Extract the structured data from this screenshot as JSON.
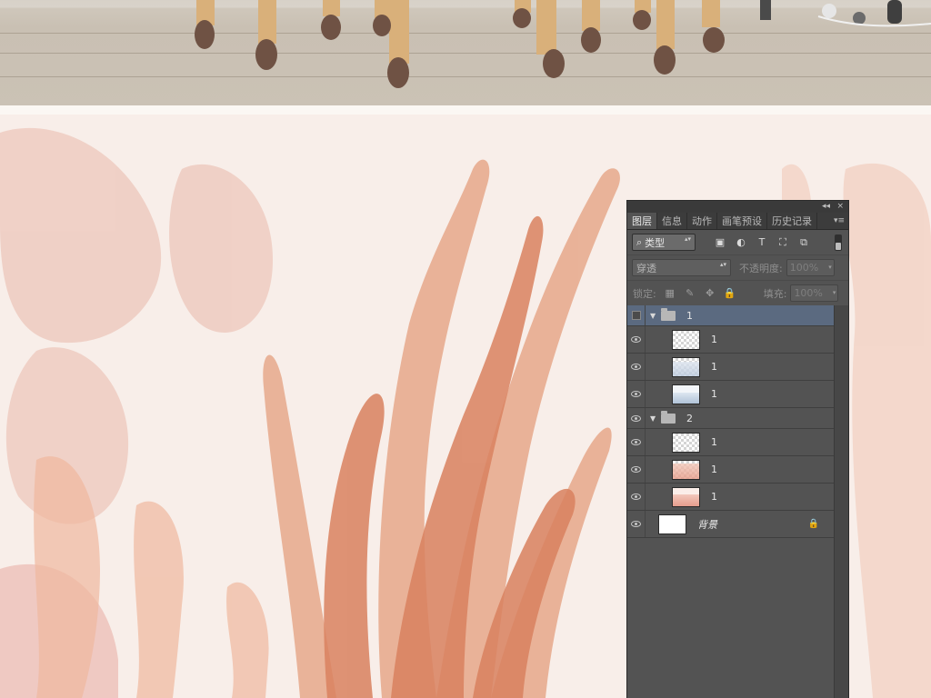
{
  "panel": {
    "collapse_glyph": "◂◂",
    "close_glyph": "×",
    "menu_glyph": "▾≡",
    "tabs": [
      {
        "label": "图层",
        "active": true
      },
      {
        "label": "信息",
        "active": false
      },
      {
        "label": "动作",
        "active": false
      },
      {
        "label": "画笔预设",
        "active": false
      },
      {
        "label": "历史记录",
        "active": false
      }
    ],
    "filter": {
      "search_icon": "⌕",
      "kind_label": "类型",
      "arrows": "▴▾",
      "icons": [
        "image-filter-icon",
        "adjustment-filter-icon",
        "type-filter-icon",
        "shape-filter-icon",
        "smart-object-filter-icon"
      ],
      "icon_glyphs": [
        "▣",
        "◐",
        "T",
        "⛶",
        "⧉"
      ]
    },
    "blend": {
      "mode": "穿透",
      "opacity_label": "不透明度:",
      "opacity_value": "100%"
    },
    "lock": {
      "label": "锁定:",
      "icon_glyphs": [
        "▦",
        "✎",
        "✥",
        "🔒"
      ],
      "fill_label": "填充:",
      "fill_value": "100%"
    },
    "layers": [
      {
        "type": "group",
        "name": "1",
        "expanded": true,
        "visible": false,
        "selected": true
      },
      {
        "type": "layer",
        "name": "1",
        "visible": true,
        "thumb": "transparent"
      },
      {
        "type": "layer",
        "name": "1",
        "visible": true,
        "thumb": "blue-texture"
      },
      {
        "type": "layer",
        "name": "1",
        "visible": true,
        "thumb": "blue-wash"
      },
      {
        "type": "group",
        "name": "2",
        "expanded": true,
        "visible": true,
        "selected": false
      },
      {
        "type": "layer",
        "name": "1",
        "visible": true,
        "thumb": "transparent"
      },
      {
        "type": "layer",
        "name": "1",
        "visible": true,
        "thumb": "coral-texture"
      },
      {
        "type": "layer",
        "name": "1",
        "visible": true,
        "thumb": "coral-wash"
      },
      {
        "type": "background",
        "name": "背景",
        "visible": true,
        "locked": true,
        "lock_glyph": "🔒"
      }
    ]
  },
  "colors": {
    "panel_bg": "#535353",
    "selection": "#5b6a80",
    "coral": "#d9815f",
    "blush": "#efc6bb"
  }
}
